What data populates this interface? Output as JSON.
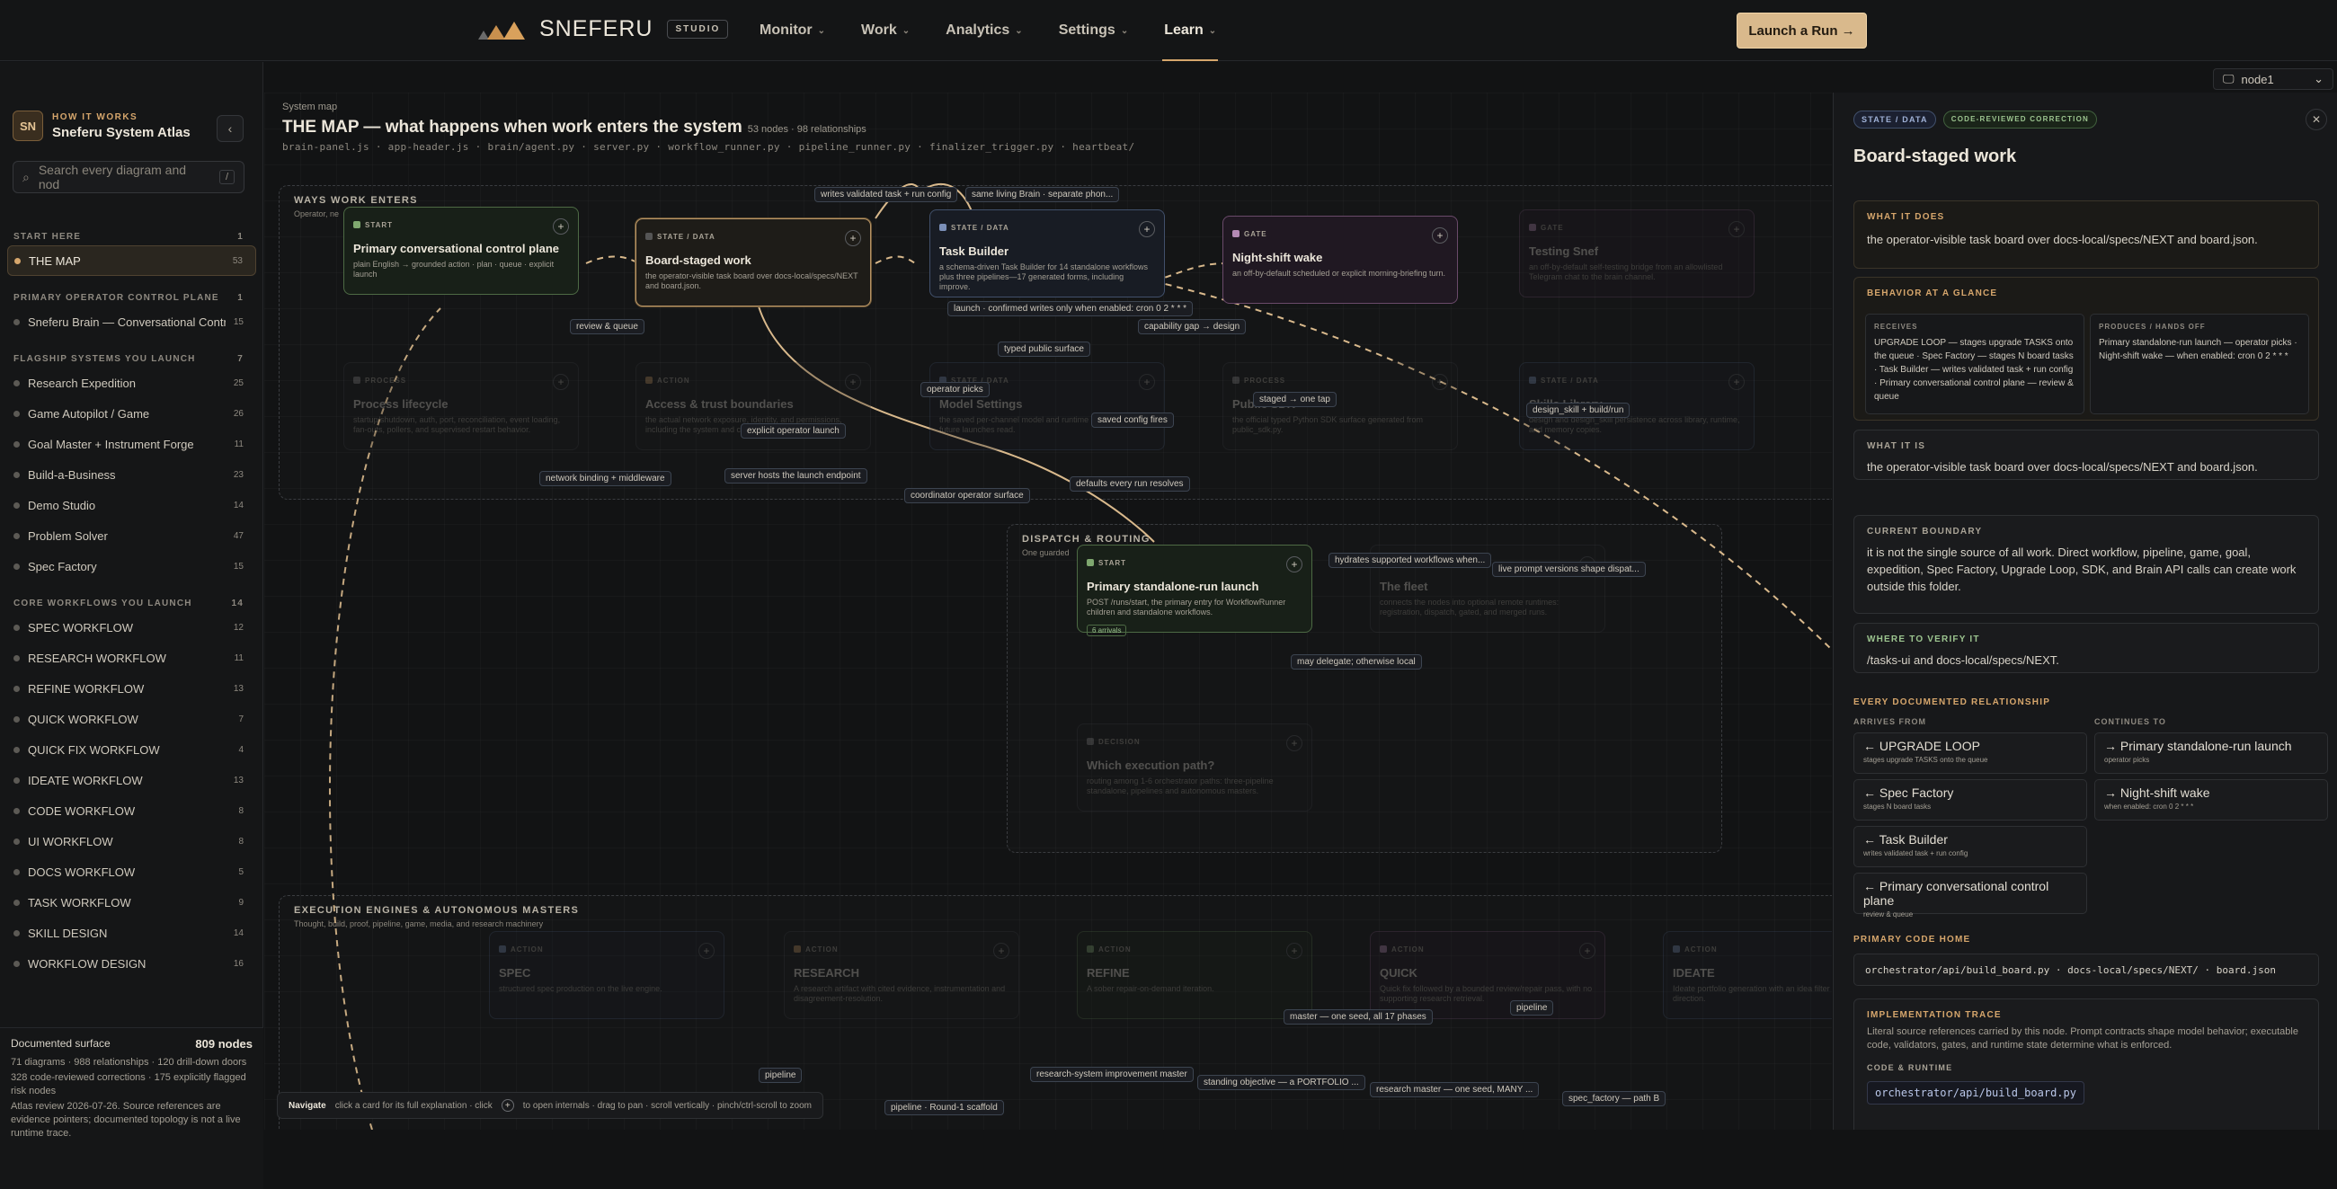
{
  "brand": {
    "name": "SNEFERU",
    "studio": "STUDIO"
  },
  "nav": [
    {
      "label": "Monitor"
    },
    {
      "label": "Work"
    },
    {
      "label": "Analytics"
    },
    {
      "label": "Settings"
    },
    {
      "label": "Learn",
      "active": true
    }
  ],
  "launch_label": "Launch a Run →",
  "node_selector": "node1",
  "sidebar": {
    "avatar": "SN",
    "kicker": "HOW IT WORKS",
    "title": "Sneferu System Atlas",
    "search_placeholder": "Search every diagram and nod",
    "search_kbd": "/",
    "sections": [
      {
        "title": "START HERE",
        "count": "1",
        "items": [
          {
            "label": "THE MAP",
            "count": "53",
            "active": true
          }
        ]
      },
      {
        "title": "PRIMARY OPERATOR CONTROL PLANE",
        "count": "1",
        "items": [
          {
            "label": "Sneferu Brain — Conversational Contro...",
            "count": "15"
          }
        ]
      },
      {
        "title": "FLAGSHIP SYSTEMS YOU LAUNCH",
        "count": "7",
        "items": [
          {
            "label": "Research Expedition",
            "count": "25"
          },
          {
            "label": "Game Autopilot / Game",
            "count": "26"
          },
          {
            "label": "Goal Master + Instrument Forge",
            "count": "11"
          },
          {
            "label": "Build-a-Business",
            "count": "23"
          },
          {
            "label": "Demo Studio",
            "count": "14"
          },
          {
            "label": "Problem Solver",
            "count": "47"
          },
          {
            "label": "Spec Factory",
            "count": "15"
          }
        ]
      },
      {
        "title": "CORE WORKFLOWS YOU LAUNCH",
        "count": "14",
        "items": [
          {
            "label": "SPEC WORKFLOW",
            "count": "12"
          },
          {
            "label": "RESEARCH WORKFLOW",
            "count": "11"
          },
          {
            "label": "REFINE WORKFLOW",
            "count": "13"
          },
          {
            "label": "QUICK WORKFLOW",
            "count": "7"
          },
          {
            "label": "QUICK FIX WORKFLOW",
            "count": "4"
          },
          {
            "label": "IDEATE WORKFLOW",
            "count": "13"
          },
          {
            "label": "CODE WORKFLOW",
            "count": "8"
          },
          {
            "label": "UI WORKFLOW",
            "count": "8"
          },
          {
            "label": "DOCS WORKFLOW",
            "count": "5"
          },
          {
            "label": "TASK WORKFLOW",
            "count": "9"
          },
          {
            "label": "SKILL DESIGN",
            "count": "14"
          },
          {
            "label": "WORKFLOW DESIGN",
            "count": "16"
          }
        ]
      }
    ],
    "footer": {
      "label": "Documented surface",
      "value": "809 nodes",
      "line1": "71 diagrams · 988 relationships · 120 drill-down doors",
      "line2": "328 code-reviewed corrections · 175 explicitly flagged risk nodes",
      "line3": "Atlas review 2026-07-26. Source references are evidence pointers; documented topology is not a live runtime trace."
    }
  },
  "map": {
    "kicker": "System map",
    "title": "THE MAP — what happens when work enters the system",
    "meta": "53 nodes · 98 relationships",
    "files": "brain-panel.js · app-header.js · brain/agent.py · server.py · workflow_runner.py · pipeline_runner.py · finalizer_trigger.py · heartbeat/",
    "regions": [
      {
        "title": "WAYS WORK ENTERS",
        "sub": "Operator, ne"
      },
      {
        "title": "DISPATCH & ROUTING",
        "sub": "One guarded"
      },
      {
        "title": "EXECUTION ENGINES & AUTONOMOUS MASTERS",
        "sub": "Thought, build, proof, pipeline, game, media, and research machinery"
      }
    ],
    "cards": [
      {
        "id": "c1",
        "type": "START",
        "title": "Primary conversational control plane",
        "desc": "plain English → grounded action · plan · queue · explicit launch",
        "cls": "start"
      },
      {
        "id": "c2",
        "type": "STATE / DATA",
        "title": "Board-staged work",
        "desc": "the operator-visible task board over docs-local/specs/NEXT and board.json.",
        "cls": "sel"
      },
      {
        "id": "c3",
        "type": "STATE / DATA",
        "title": "Task Builder",
        "desc": "a schema-driven Task Builder for 14 standalone workflows plus three pipelines—17 generated forms, including improve.",
        "cls": "state"
      },
      {
        "id": "c4",
        "type": "GATE",
        "title": "Night-shift wake",
        "desc": "an off-by-default scheduled or explicit morning-briefing turn.",
        "cls": "gate"
      },
      {
        "id": "c5",
        "type": "GATE",
        "title": "Testing Snef",
        "desc": "an off-by-default self-testing bridge from an allowlisted Telegram chat to the brain channel.",
        "cls": "gate dim"
      },
      {
        "id": "c6",
        "type": "PROCESS",
        "title": "Process lifecycle",
        "desc": "startup/shutdown, auth, port, reconciliation, event loading, fan-outs, pollers, and supervised restart behavior.",
        "cls": "process dim"
      },
      {
        "id": "c7",
        "type": "ACTION",
        "title": "Access & trust boundaries",
        "desc": "the actual network exposure, identity, and permissions, including the system and coordinator-key boundary.",
        "cls": "action dim"
      },
      {
        "id": "c8",
        "type": "STATE / DATA",
        "title": "Model Settings",
        "desc": "the saved per-channel model and runtime defaults that future launches read.",
        "cls": "state dim"
      },
      {
        "id": "c9",
        "type": "PROCESS",
        "title": "Public SDK",
        "desc": "the official typed Python SDK surface generated from public_sdk.py.",
        "cls": "process dim"
      },
      {
        "id": "c10",
        "type": "STATE / DATA",
        "title": "Skills Library",
        "desc": "design and design_skill persistence across library, runtime, and memory copies.",
        "cls": "state dim"
      },
      {
        "id": "c11",
        "type": "START",
        "title": "Primary standalone-run launch",
        "desc": "POST /runs/start, the primary entry for WorkflowRunner children and standalone workflows.",
        "cls": "start",
        "chip": "6 arrivals"
      },
      {
        "id": "c12",
        "type": "PROCESS",
        "title": "The fleet",
        "desc": "connects the nodes into optional remote runtimes: registration, dispatch, gated, and merged runs.",
        "cls": "process dim"
      },
      {
        "id": "c13",
        "type": "DECISION",
        "title": "Which execution path?",
        "desc": "routing among 1-6 orchestrator paths: three-pipeline standalone, pipelines and autonomous masters.",
        "cls": "process dim"
      },
      {
        "id": "c14",
        "type": "ACTION",
        "title": "SPEC",
        "desc": "structured spec production on the live engine.",
        "cls": "state dim"
      },
      {
        "id": "c15",
        "type": "ACTION",
        "title": "RESEARCH",
        "desc": "A research artifact with cited evidence, instrumentation and disagreement-resolution.",
        "cls": "action dim"
      },
      {
        "id": "c16",
        "type": "ACTION",
        "title": "REFINE",
        "desc": "A sober repair-on-demand iteration.",
        "cls": "start dim"
      },
      {
        "id": "c17",
        "type": "ACTION",
        "title": "QUICK",
        "desc": "Quick fix followed by a bounded review/repair pass, with no supporting research retrieval.",
        "cls": "gate dim"
      },
      {
        "id": "c18",
        "type": "ACTION",
        "title": "IDEATE",
        "desc": "Ideate portfolio generation with an idea filter pass, the best direction.",
        "cls": "state dim"
      }
    ],
    "edge_labels": [
      "writes validated task + run config",
      "same living Brain · separate phon...",
      "review & queue",
      "launch · confirmed writes only when enabled: cron 0 2 * * *",
      "capability gap → design",
      "typed public surface",
      "operator picks",
      "explicit operator launch",
      "saved config fires",
      "staged → one tap",
      "design_skill + build/run",
      "network binding + middleware",
      "server hosts the launch endpoint",
      "coordinator operator surface",
      "defaults every run resolves",
      "hydrates supported workflows when...",
      "live prompt versions shape dispat...",
      "may delegate; otherwise local",
      "master — one seed, all 17 phases",
      "pipeline",
      "pipeline",
      "research-system improvement master",
      "standing objective — a PORTFOLIO ...",
      "research master — one seed, MANY ...",
      "spec_factory — path B",
      "pipeline · Round-1 scaffold"
    ],
    "hint": {
      "label": "Navigate",
      "text1": "click a card for its full explanation · click",
      "text2": "to open internals · drag to pan · scroll vertically · pinch/ctrl-scroll to zoom"
    }
  },
  "panel": {
    "badge1": "STATE / DATA",
    "badge2": "CODE-REVIEWED CORRECTION",
    "title": "Board-staged work",
    "what_it_does_label": "WHAT IT DOES",
    "what_it_does": "the operator-visible task board over docs-local/specs/NEXT and board.json.",
    "glance_label": "BEHAVIOR AT A GLANCE",
    "receives_label": "RECEIVES",
    "receives": "UPGRADE LOOP — stages upgrade TASKS onto the queue · Spec Factory — stages N board tasks · Task Builder — writes validated task + run config · Primary conversational control plane — review & queue",
    "produces_label": "PRODUCES / HANDS OFF",
    "produces": "Primary standalone-run launch — operator picks · Night-shift wake — when enabled: cron 0 2 * * *",
    "what_it_is_label": "WHAT IT IS",
    "what_it_is": "the operator-visible task board over docs-local/specs/NEXT and board.json.",
    "boundary_label": "CURRENT BOUNDARY",
    "boundary": "it is not the single source of all work. Direct workflow, pipeline, game, goal, expedition, Spec Factory, Upgrade Loop, SDK, and Brain API calls can create work outside this folder.",
    "verify_label": "WHERE TO VERIFY IT",
    "verify": "/tasks-ui and docs-local/specs/NEXT.",
    "rel_label": "EVERY DOCUMENTED RELATIONSHIP",
    "arrives_label": "ARRIVES FROM",
    "continues_label": "CONTINUES TO",
    "arrives": [
      {
        "name": "← UPGRADE LOOP",
        "sub": "stages upgrade TASKS onto the queue"
      },
      {
        "name": "← Spec Factory",
        "sub": "stages N board tasks"
      },
      {
        "name": "← Task Builder",
        "sub": "writes validated task + run config"
      },
      {
        "name": "← Primary conversational control plane",
        "sub": "review & queue"
      }
    ],
    "continues": [
      {
        "name": "→ Primary standalone-run launch",
        "sub": "operator picks"
      },
      {
        "name": "→ Night-shift wake",
        "sub": "when enabled: cron 0 2 * * *"
      }
    ],
    "code_home_label": "PRIMARY CODE HOME",
    "code_home": "orchestrator/api/build_board.py · docs-local/specs/NEXT/ · board.json",
    "trace_label": "IMPLEMENTATION TRACE",
    "trace": "Literal source references carried by this node. Prompt contracts shape model behavior; executable code, validators, gates, and runtime state determine what is enforced.",
    "code_runtime_label": "CODE & RUNTIME",
    "code_runtime": "orchestrator/api/build_board.py"
  }
}
